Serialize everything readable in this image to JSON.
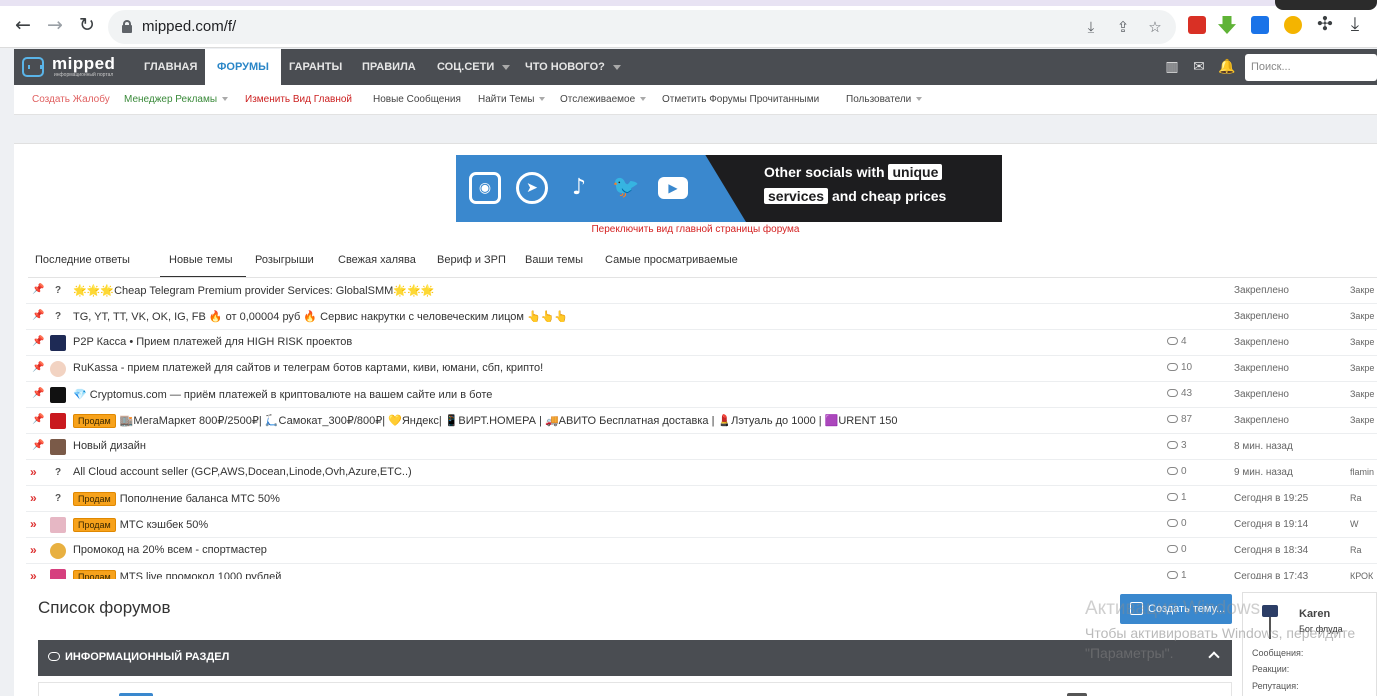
{
  "browser": {
    "url": "mipped.com/f/"
  },
  "site": {
    "logo_text": "mipped",
    "logo_sub": "информационный портал",
    "nav": [
      "Главная",
      "Форумы",
      "Гаранты",
      "Правила",
      "Соц.сети",
      "Что нового?"
    ],
    "search_placeholder": "Поиск..."
  },
  "subnav": [
    {
      "label": "Создать Жалобу",
      "color": "#e06060"
    },
    {
      "label": "Менеджер Рекламы",
      "color": "#3a8a3a"
    },
    {
      "label": "Изменить Вид Главной",
      "color": "#cc1f1f"
    },
    {
      "label": "Новые Сообщения",
      "color": "#444444"
    },
    {
      "label": "Найти Темы",
      "color": "#444444"
    },
    {
      "label": "Отслеживаемое",
      "color": "#444444"
    },
    {
      "label": "Отметить Форумы Прочитанными",
      "color": "#444444"
    },
    {
      "label": "Пользователи",
      "color": "#444444"
    }
  ],
  "banner": {
    "line1": "Other socials with",
    "line1_hl": "unique",
    "line2_hl": "services",
    "line2": "and cheap prices"
  },
  "switch_link": "Переключить вид главной страницы форума",
  "tabs": [
    "Последние ответы",
    "Новые темы",
    "Розыгрыши",
    "Свежая халява",
    "Вериф и ЗРП",
    "Ваши темы",
    "Самые просматриваемые"
  ],
  "threads": [
    {
      "title": "🌟🌟🌟Cheap Telegram Premium provider Services: GlobalSMM🌟🌟🌟",
      "replies": "",
      "status": "Закреплено",
      "who": "Закре"
    },
    {
      "title": "TG, YT, TT, VK, OK, IG, FB 🔥 от 0,00004 руб 🔥 Сервис накрутки с человеческим лицом 👆👆👆",
      "replies": "",
      "status": "Закреплено",
      "who": "Закре"
    },
    {
      "title": "P2P Касса • Прием платежей для HIGH RISK проектов",
      "replies": "4",
      "status": "Закреплено",
      "who": "Закре"
    },
    {
      "title": "RuKassa - прием платежей для сайтов и телеграм ботов картами, киви, юмани, сбп, крипто!",
      "replies": "10",
      "status": "Закреплено",
      "who": "Закре"
    },
    {
      "title": "💎 Cryptomus.com — приём платежей в криптовалюте на вашем сайте или в боте",
      "replies": "43",
      "status": "Закреплено",
      "who": "Закре"
    },
    {
      "prefix": "Продам",
      "title": "🏬МегаМаркет 800₽/2500₽| 🛴Самокат_300₽/800₽| 💛Яндекс| 📱ВИРТ.НОМЕРА | 🚚АВИТО Бесплатная доставка | 💄Лэтуаль до 1000 | 🟪URENT 150",
      "replies": "87",
      "status": "Закреплено",
      "who": "Закре"
    },
    {
      "title": "Новый дизайн",
      "replies": "3",
      "status": "8 мин. назад",
      "who": ""
    },
    {
      "title": "All Cloud account seller (GCP,AWS,Docean,Linode,Ovh,Azure,ETC..)",
      "replies": "0",
      "status": "9 мин. назад",
      "who": "flamin"
    },
    {
      "prefix": "Продам",
      "title": "Пополнение баланса МТС 50%",
      "replies": "1",
      "status": "Сегодня в 19:25",
      "who": "Ra"
    },
    {
      "prefix": "Продам",
      "title": "МТС кэшбек 50%",
      "replies": "0",
      "status": "Сегодня в 19:14",
      "who": "W"
    },
    {
      "title": "Промокод на 20% всем - спортмастер",
      "replies": "0",
      "status": "Сегодня в 18:34",
      "who": "Ra"
    },
    {
      "prefix": "Продам",
      "title": "MTS live промокод 1000 рублей",
      "replies": "1",
      "status": "Сегодня в 17:43",
      "who": "КРОК"
    }
  ],
  "forum_list": {
    "title": "Список форумов",
    "new_thread": "Создать тему...",
    "section": "Информационный раздел"
  },
  "member": {
    "name": "Karen",
    "role": "Бог флуда",
    "stat1": "Сообщения:",
    "stat2": "Реакции:",
    "stat3": "Репутация:"
  },
  "watermark": {
    "title": "Активация Windows",
    "line1": "Чтобы активировать Windows, перейдите",
    "line2": "\"Параметры\"."
  },
  "colors": {
    "accent": "#3a88ce",
    "nav_bg": "#4a4d52",
    "prefix": "#f7a21b",
    "pin": "#cc2a2a"
  }
}
